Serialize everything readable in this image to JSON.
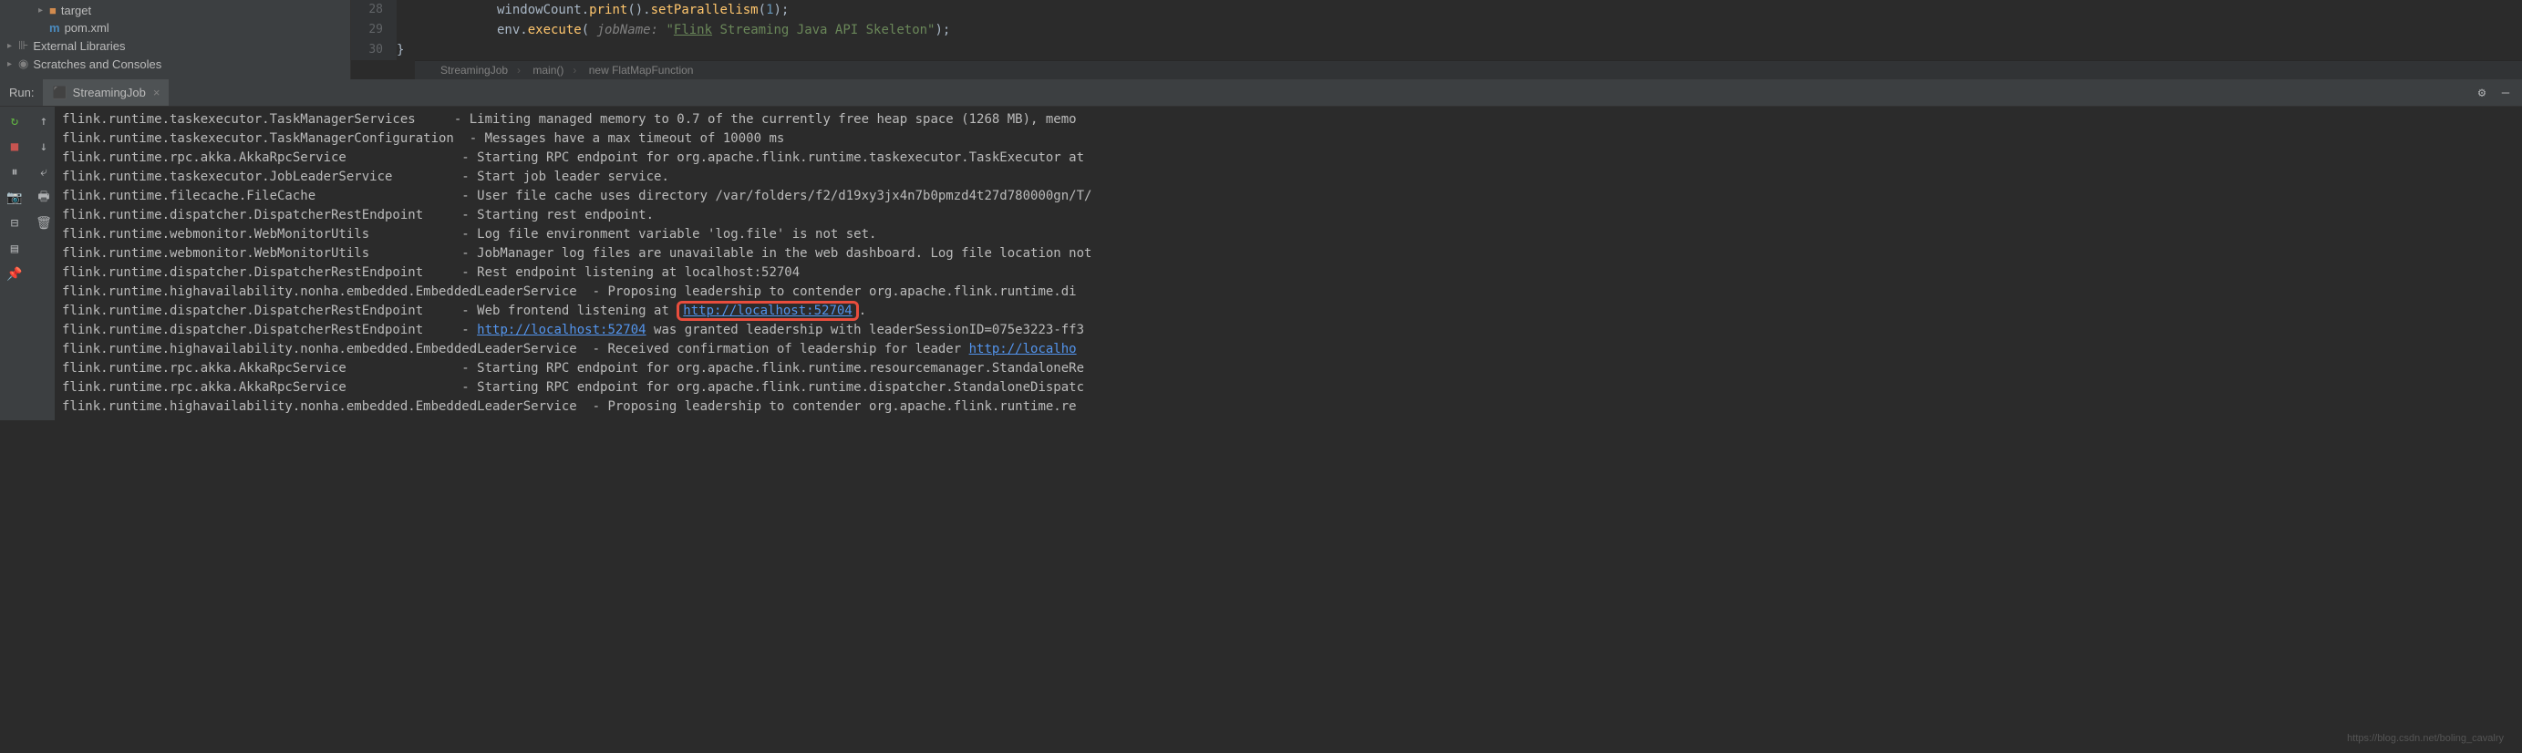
{
  "project_tree": {
    "items": [
      {
        "indent": 2,
        "arrow": "▸",
        "icon_type": "folder",
        "label": "target"
      },
      {
        "indent": 2,
        "arrow": "",
        "icon_type": "maven",
        "label": "pom.xml"
      },
      {
        "indent": 0,
        "arrow": "▸",
        "icon_type": "lib",
        "label": "External Libraries"
      },
      {
        "indent": 0,
        "arrow": "▸",
        "icon_type": "scratch",
        "label": "Scratches and Consoles"
      }
    ]
  },
  "editor": {
    "gutter": [
      "28",
      "29",
      "30"
    ],
    "code_lines": [
      {
        "parts": [
          {
            "t": "windowCount.",
            "c": ""
          },
          {
            "t": "print",
            "c": "method"
          },
          {
            "t": "().",
            "c": ""
          },
          {
            "t": "setParallelism",
            "c": "method"
          },
          {
            "t": "(",
            "c": ""
          },
          {
            "t": "1",
            "c": "number"
          },
          {
            "t": ");",
            "c": ""
          }
        ]
      },
      {
        "parts": [
          {
            "t": "env.",
            "c": ""
          },
          {
            "t": "execute",
            "c": "method"
          },
          {
            "t": "( ",
            "c": ""
          },
          {
            "t": "jobName: ",
            "c": "param"
          },
          {
            "t": "\"",
            "c": "string"
          },
          {
            "t": "Flink",
            "c": "string underline"
          },
          {
            "t": " Streaming Java API Skeleton\"",
            "c": "string"
          },
          {
            "t": ");",
            "c": ""
          }
        ]
      },
      {
        "parts": [
          {
            "t": "}",
            "c": ""
          }
        ]
      }
    ]
  },
  "breadcrumb": {
    "items": [
      "StreamingJob",
      "main()",
      "new FlatMapFunction"
    ]
  },
  "run": {
    "label": "Run:",
    "tab": {
      "name": "StreamingJob"
    }
  },
  "console_lines": [
    {
      "prefix": "flink.runtime.taskexecutor.TaskManagerServices     - Limiting managed memory to 0.7 of the currently free heap space (1268 MB), memo"
    },
    {
      "prefix": "flink.runtime.taskexecutor.TaskManagerConfiguration  - Messages have a max timeout of 10000 ms"
    },
    {
      "prefix": "flink.runtime.rpc.akka.AkkaRpcService               - Starting RPC endpoint for org.apache.flink.runtime.taskexecutor.TaskExecutor at"
    },
    {
      "prefix": "flink.runtime.taskexecutor.JobLeaderService         - Start job leader service."
    },
    {
      "prefix": "flink.runtime.filecache.FileCache                   - User file cache uses directory /var/folders/f2/d19xy3jx4n7b0pmzd4t27d780000gn/T/"
    },
    {
      "prefix": "flink.runtime.dispatcher.DispatcherRestEndpoint     - Starting rest endpoint."
    },
    {
      "prefix": "flink.runtime.webmonitor.WebMonitorUtils            - Log file environment variable 'log.file' is not set."
    },
    {
      "prefix": "flink.runtime.webmonitor.WebMonitorUtils            - JobManager log files are unavailable in the web dashboard. Log file location not"
    },
    {
      "prefix": "flink.runtime.dispatcher.DispatcherRestEndpoint     - Rest endpoint listening at localhost:52704"
    },
    {
      "prefix": "flink.runtime.highavailability.nonha.embedded.EmbeddedLeaderService  - Proposing leadership to contender org.apache.flink.runtime.di"
    },
    {
      "prefix": "flink.runtime.dispatcher.DispatcherRestEndpoint     - Web frontend listening at ",
      "url": "http://localhost:52704",
      "highlight": true,
      "suffix": "."
    },
    {
      "prefix": "flink.runtime.dispatcher.DispatcherRestEndpoint     - ",
      "url": "http://localhost:52704",
      "suffix": " was granted leadership with leaderSessionID=075e3223-ff3"
    },
    {
      "prefix": "flink.runtime.highavailability.nonha.embedded.EmbeddedLeaderService  - Received confirmation of leadership for leader ",
      "url": "http://localho"
    },
    {
      "prefix": "flink.runtime.rpc.akka.AkkaRpcService               - Starting RPC endpoint for org.apache.flink.runtime.resourcemanager.StandaloneRe"
    },
    {
      "prefix": "flink.runtime.rpc.akka.AkkaRpcService               - Starting RPC endpoint for org.apache.flink.runtime.dispatcher.StandaloneDispatc"
    },
    {
      "prefix": "flink.runtime.highavailability.nonha.embedded.EmbeddedLeaderService  - Proposing leadership to contender org.apache.flink.runtime.re"
    }
  ],
  "watermark": "https://blog.csdn.net/boling_cavalry"
}
